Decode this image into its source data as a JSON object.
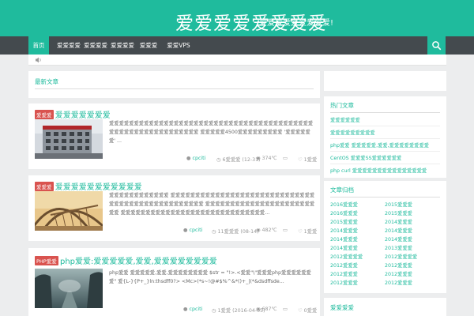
{
  "header": {
    "title": "爱爱爱爱爱爱爱爱",
    "subtitle": "爱爱爱爱爱爱爱爱爱!"
  },
  "nav": {
    "items": [
      "首页",
      "爱爱爱爱",
      "爱爱爱爱",
      "爱爱爱爱",
      "爱爱爱",
      "爱爱VPS"
    ]
  },
  "main": {
    "section_title": "最新文章"
  },
  "posts": [
    {
      "category": "爱爱爱",
      "title": "爱爱爱爱爱爱爱",
      "excerpt": "爱爱爱爱爱爱爱爱爱爱爱爱爱爱爱爱爱爱爱爱爱爱爱爱爱爱爱爱爱爱爱爱爱爱爱爱爱爱爱爱爱爱爱爱爱爱爱爱爱爱爱爱爱爱爱爱爱爱爱 爱爱爱爱爱4500爱爱爱爱爱爱爱爱爱 '爱爱爱爱爱爱' ...",
      "author": "cpciti",
      "date": "6爱爱爱 (12-31)",
      "views": "374℃",
      "comments": "",
      "likes": "1爱爱"
    },
    {
      "category": "爱爱爱",
      "title": "爱爱爱爱爱爱爱爱爱爱爱",
      "excerpt": "爱爱爱爱爱爱爱爱爱爱爱爱 爱爱爱爱爱爱爱爱爱爱爱爱爱爱爱爱爱爱爱爱爱爱爱爱爱爱爱爱爱爱爱爱爱爱爱爱爱爱爱爱爱爱爱爱爱爱爱爱 爱爱爱爱爱爱爱爱爱爱爱爱爱爱爱爱爱爱爱爱爱爱爱爱 爱爱爱爱爱爱爱爱爱爱爱爱爱爱爱爱爱爱爱爱爱爱爱爱爱爱爱爱爱...",
      "author": "cpciti",
      "date": "11爱爱爱 (08-14)",
      "views": "482℃",
      "comments": "",
      "likes": "1爱爱"
    },
    {
      "category": "PHP爱爱",
      "title": "php爱爱:爱爱爱爱爱,爱爱,爱爱爱爱爱爱爱爱",
      "excerpt": "php爱爱 爱爱爱爱爱,爱爱,爱爱爱爱爱爱爱爱 $str = \"!>.<爱爱\"\\\"爱爱爱php爱爱爱爱爱爱爱\" 爱{L-}{P+_}ln:thsdff0?> <Mc>(*s~!@#$%^&*()+_|(*&dsdffsde...",
      "author": "cpciti",
      "date": "1爱爱 (2016-04-05)",
      "views": "687℃",
      "comments": "",
      "likes": "0爱爱"
    }
  ],
  "sidebar": {
    "hot_title": "热门文章",
    "hot_items": [
      "爱爱爱爱爱爱",
      "爱爱爱爱爱爱爱爱爱",
      "php爱爱 爱爱爱爱爱,爱爱,爱爱爱爱爱爱爱爱",
      "CentOS 爱爱爱SS爱爱爱爱爱爱",
      "php curl 爱爱爱爱爱爱爱爱爱爱爱爱爱爱爱"
    ],
    "archive_title": "文章归档",
    "archive_left": [
      "2016爱爱爱",
      "2016爱爱爱",
      "2015爱爱爱",
      "2014爱爱爱",
      "2014爱爱爱",
      "2014爱爱爱",
      "2012爱爱爱爱",
      "2012爱爱爱",
      "2012爱爱爱",
      "2012爱爱爱"
    ],
    "archive_right": [
      "2015爱爱爱",
      "2015爱爱爱",
      "2014爱爱爱",
      "2014爱爱爱",
      "2014爱爱爱",
      "2013爱爱爱",
      "2012爱爱爱爱",
      "2012爱爱爱",
      "2012爱爱爱",
      "2012爱爱爱"
    ],
    "third_title": "爱爱爱爱"
  }
}
